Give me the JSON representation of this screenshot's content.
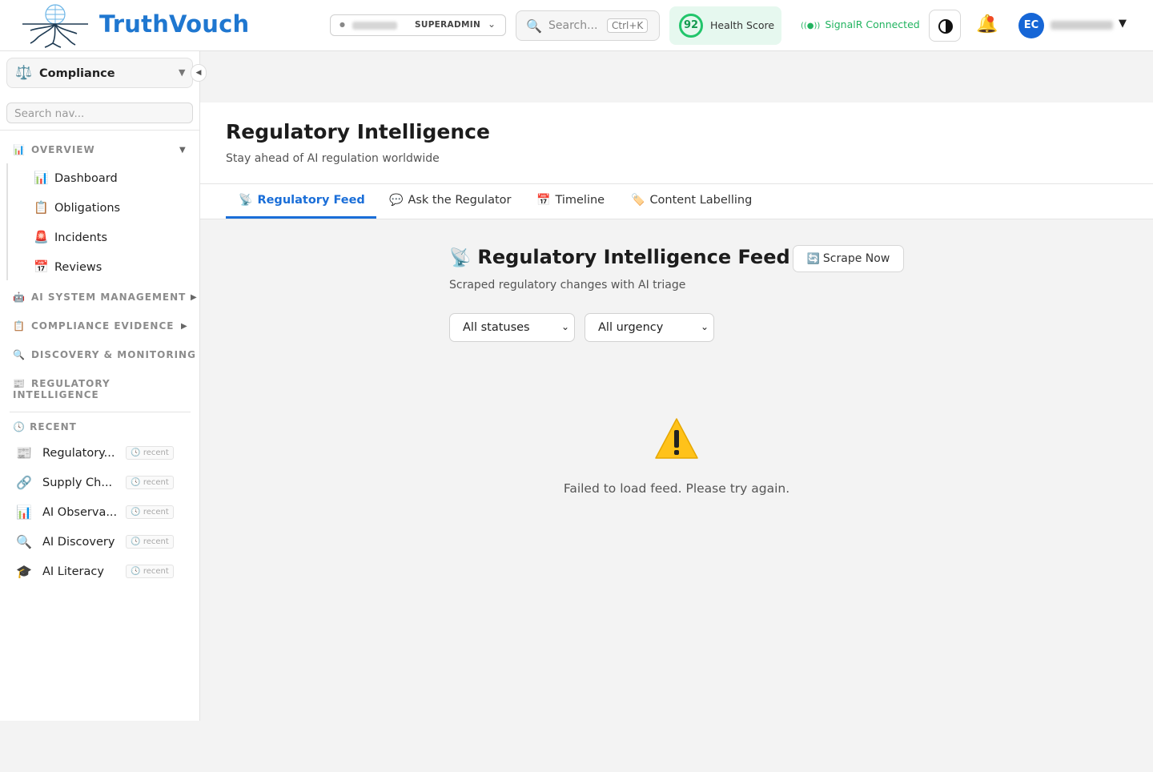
{
  "header": {
    "brand": "TruthVouch",
    "tenant_role": "SUPERADMIN",
    "search_placeholder": "Search...",
    "search_shortcut": "Ctrl+K",
    "health_score": "92",
    "health_label": "Health Score",
    "signal_status": "SignalR Connected",
    "avatar_initials": "EC"
  },
  "sidebar": {
    "context": "Compliance",
    "search_placeholder": "Search nav...",
    "sections": [
      {
        "label": "OVERVIEW"
      },
      {
        "label": "AI SYSTEM MANAGEMENT"
      },
      {
        "label": "COMPLIANCE EVIDENCE"
      },
      {
        "label": "DISCOVERY & MONITORING"
      },
      {
        "label": "REGULATORY INTELLIGENCE"
      }
    ],
    "overview_items": [
      {
        "label": "Dashboard"
      },
      {
        "label": "Obligations"
      },
      {
        "label": "Incidents"
      },
      {
        "label": "Reviews"
      }
    ],
    "recent_label": "RECENT",
    "recent_items": [
      {
        "label": "Regulatory...",
        "badge": "recent"
      },
      {
        "label": "Supply Ch...",
        "badge": "recent"
      },
      {
        "label": "AI Observa...",
        "badge": "recent"
      },
      {
        "label": "AI Discovery",
        "badge": "recent"
      },
      {
        "label": "AI Literacy",
        "badge": "recent"
      }
    ]
  },
  "page": {
    "title": "Regulatory Intelligence",
    "subtitle": "Stay ahead of AI regulation worldwide",
    "tabs": [
      {
        "label": "Regulatory Feed"
      },
      {
        "label": "Ask the Regulator"
      },
      {
        "label": "Timeline"
      },
      {
        "label": "Content Labelling"
      }
    ]
  },
  "feed": {
    "title": "Regulatory Intelligence Feed",
    "scrape_label": "Scrape Now",
    "subtitle": "Scraped regulatory changes with AI triage",
    "status_filter": "All statuses",
    "urgency_filter": "All urgency",
    "error_message": "Failed to load feed. Please try again."
  },
  "colors": {
    "brand": "#1f77d0",
    "accent": "#1a6ed8",
    "success": "#22c56b"
  }
}
